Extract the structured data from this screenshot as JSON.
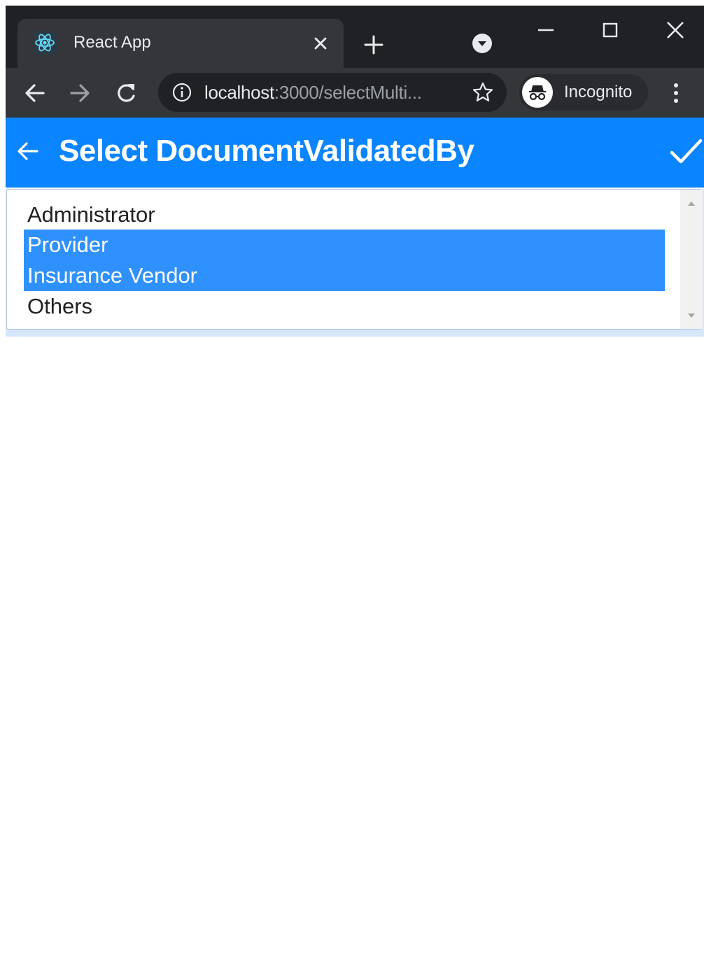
{
  "browser": {
    "tab": {
      "title": "React App",
      "favicon": "react-logo-icon"
    },
    "address": {
      "host": "localhost",
      "path": ":3000/selectMulti..."
    },
    "profile": {
      "label": "Incognito"
    },
    "icons": {
      "tab_close": "close-icon",
      "new_tab": "plus-icon",
      "tab_search": "tab-search-icon",
      "minimize": "minimize-icon",
      "maximize": "maximize-icon",
      "window_close": "close-icon",
      "back": "arrow-left-icon",
      "forward": "arrow-right-icon",
      "reload": "reload-icon",
      "site_info": "info-icon",
      "bookmark": "star-icon",
      "menu": "kebab-menu-icon"
    },
    "colors": {
      "frame": "#202124",
      "toolbar": "#35363a"
    }
  },
  "app": {
    "header": {
      "title": "Select DocumentValidatedBy",
      "back_icon": "arrow-left-icon",
      "confirm_icon": "check-icon",
      "color": "#0a84ff"
    },
    "select": {
      "options": [
        {
          "label": "Administrator",
          "selected": false
        },
        {
          "label": "Provider",
          "selected": true
        },
        {
          "label": "Insurance Vendor",
          "selected": true
        },
        {
          "label": "Others",
          "selected": false
        }
      ],
      "selected_color": "#2f91fd"
    }
  }
}
